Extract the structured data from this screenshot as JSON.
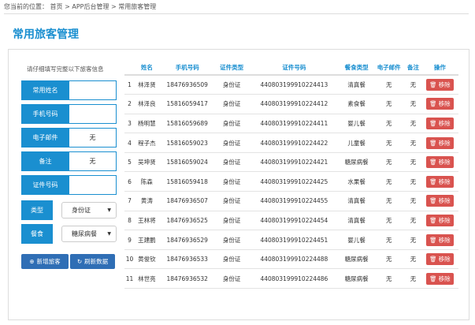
{
  "breadcrumb": {
    "prefix": "您当前的位置：",
    "items": [
      "首页",
      "APP后台管理",
      "常用旅客管理"
    ],
    "sep": ">"
  },
  "page_title": "常用旅客管理",
  "form": {
    "hint": "请仔细填写完整以下旅客信息",
    "fields": [
      {
        "label": "常用姓名",
        "value": ""
      },
      {
        "label": "手机号码",
        "value": ""
      },
      {
        "label": "电子邮件",
        "value": "无"
      },
      {
        "label": "备注",
        "value": "无"
      },
      {
        "label": "证件号码",
        "value": ""
      }
    ],
    "selects": [
      {
        "label": "类型",
        "value": "身份证"
      },
      {
        "label": "餐食",
        "value": "糖尿病餐"
      }
    ],
    "add_button": "新增旅客",
    "refresh_button": "刷新数据"
  },
  "table": {
    "headers": [
      "",
      "姓名",
      "手机号码",
      "证件类型",
      "证件号码",
      "餐食类型",
      "电子邮件",
      "备注",
      "操作"
    ],
    "remove_label": "移除",
    "rows": [
      [
        "1",
        "林泽贤",
        "18476936509",
        "身份证",
        "440803199910224413",
        "清真餐",
        "无",
        "无"
      ],
      [
        "2",
        "林泽良",
        "15816059417",
        "身份证",
        "440803199910224412",
        "素食餐",
        "无",
        "无"
      ],
      [
        "3",
        "杨明慧",
        "15816059689",
        "身份证",
        "440803199910224411",
        "婴儿餐",
        "无",
        "无"
      ],
      [
        "4",
        "程子杰",
        "15816059023",
        "身份证",
        "440803199910224422",
        "儿童餐",
        "无",
        "无"
      ],
      [
        "5",
        "吴坤贤",
        "15816059024",
        "身份证",
        "440803199910224421",
        "糖尿病餐",
        "无",
        "无"
      ],
      [
        "6",
        "陈森",
        "15816059418",
        "身份证",
        "440803199910224425",
        "水果餐",
        "无",
        "无"
      ],
      [
        "7",
        "黄涛",
        "18476936507",
        "身份证",
        "440803199910224455",
        "清真餐",
        "无",
        "无"
      ],
      [
        "8",
        "王林将",
        "18476936525",
        "身份证",
        "440803199910224454",
        "清真餐",
        "无",
        "无"
      ],
      [
        "9",
        "王建鹏",
        "18476936529",
        "身份证",
        "440803199910224451",
        "婴儿餐",
        "无",
        "无"
      ],
      [
        "10",
        "黄俊钦",
        "18476936533",
        "身份证",
        "440803199910224488",
        "糖尿病餐",
        "无",
        "无"
      ],
      [
        "11",
        "林世亮",
        "18476936532",
        "身份证",
        "440803199910224486",
        "糖尿病餐",
        "无",
        "无"
      ]
    ]
  },
  "colors": {
    "primary": "#1a8fd0",
    "button": "#2f6eb5",
    "danger": "#d9534f"
  }
}
